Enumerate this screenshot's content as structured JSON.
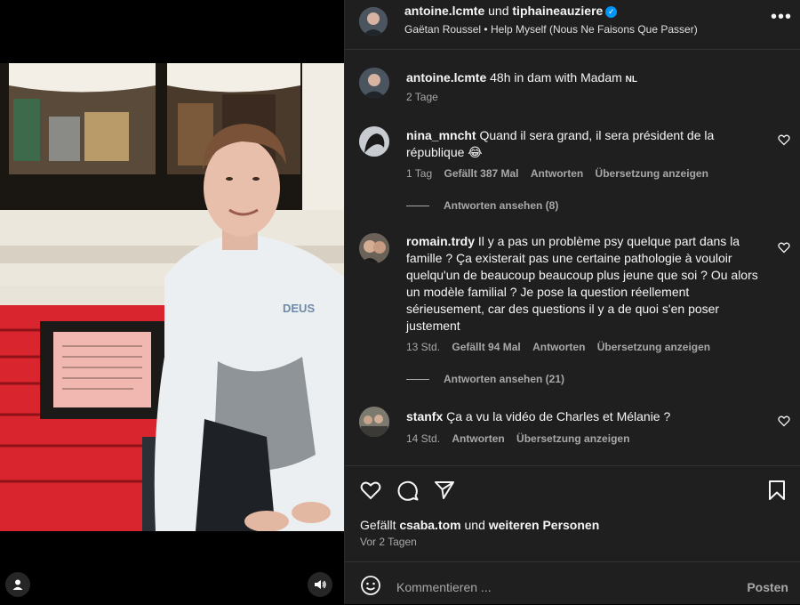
{
  "header": {
    "user1": "antoine.lcmte",
    "joiner": "und",
    "user2": "tiphaineauziere",
    "music_artist": "Gaëtan Roussel",
    "music_separator": "•",
    "music_title": "Help Myself (Nous Ne Faisons Que Passer)"
  },
  "caption": {
    "username": "antoine.lcmte",
    "text": "48h in dam with Madam",
    "flag": "NL",
    "time": "2 Tage"
  },
  "comments": [
    {
      "username": "nina_mncht",
      "text": "Quand il sera grand, il sera président de la république 😂",
      "time": "1 Tag",
      "likes": "Gefällt 387 Mal",
      "reply": "Antworten",
      "translate": "Übersetzung anzeigen",
      "view_replies": "Antworten ansehen (8)"
    },
    {
      "username": "romain.trdy",
      "text": "Il y a pas un problème psy quelque part dans la famille ? Ça existerait pas une certaine pathologie à vouloir quelqu'un de beaucoup beaucoup plus jeune que soi ? Ou alors un modèle familial ? Je pose la question réellement sérieusement, car des questions il y a de quoi s'en poser justement",
      "time": "13 Std.",
      "likes": "Gefällt 94 Mal",
      "reply": "Antworten",
      "translate": "Übersetzung anzeigen",
      "view_replies": "Antworten ansehen (21)"
    },
    {
      "username": "stanfx",
      "text": "Ça a vu la vidéo de Charles et Mélanie ?",
      "time": "14 Std.",
      "reply": "Antworten",
      "translate": "Übersetzung anzeigen"
    }
  ],
  "likes_line": {
    "prefix": "Gefällt",
    "user": "csaba.tom",
    "middle": "und",
    "others": "weiteren Personen"
  },
  "post_date": "Vor 2 Tagen",
  "composer": {
    "placeholder": "Kommentieren ...",
    "post_button": "Posten"
  },
  "icons": {
    "more": "more-icon",
    "heart": "heart-icon",
    "comment": "comment-icon",
    "share": "share-icon",
    "bookmark": "bookmark-icon",
    "emoji": "emoji-icon",
    "user": "user-icon",
    "sound": "sound-icon"
  },
  "colors": {
    "panel_bg": "#1f1f1f",
    "verified": "#0095f6",
    "bench": "#d9262e"
  }
}
